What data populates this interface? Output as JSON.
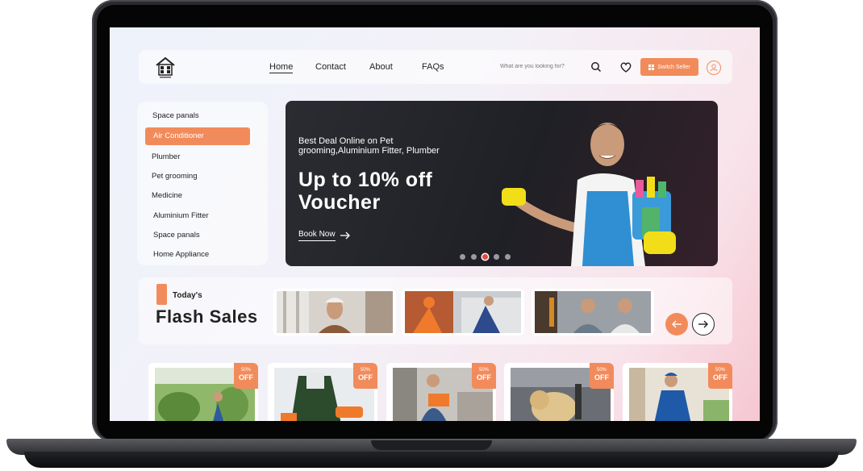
{
  "nav": {
    "links": [
      "Home",
      "Contact",
      "About",
      "FAQs"
    ],
    "search_placeholder": "What are you looking for?",
    "switch_seller_label": "Switch Seller"
  },
  "sidebar": {
    "items": [
      {
        "label": "Space panals"
      },
      {
        "label": "Air Conditioner",
        "active": true
      },
      {
        "label": "Plumber"
      },
      {
        "label": "Pet grooming"
      },
      {
        "label": "Medicine"
      },
      {
        "label": "Aluminium Fitter"
      },
      {
        "label": "Space panals"
      },
      {
        "label": "Home Appliance"
      }
    ]
  },
  "banner": {
    "subtitle": "Best Deal Online on Pet grooming,Aluminium Fitter, Plumber",
    "title": "Up to 10% off Voucher",
    "cta": "Book Now",
    "slide_count": 5,
    "active_slide": 3
  },
  "flash": {
    "eyebrow": "Today's",
    "title": "Flash Sales"
  },
  "products": [
    {
      "discount": "50%",
      "off": "OFF"
    },
    {
      "discount": "50%",
      "off": "OFF"
    },
    {
      "discount": "50%",
      "off": "OFF"
    },
    {
      "discount": "50%",
      "off": "OFF"
    },
    {
      "discount": "50%",
      "off": "OFF"
    }
  ],
  "colors": {
    "accent": "#f28b5b",
    "banner_bg": "#1f2025",
    "active_dot": "#e4493f"
  }
}
